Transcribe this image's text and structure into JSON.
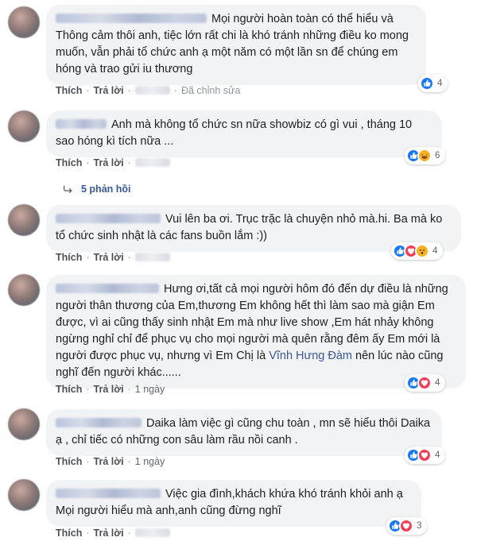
{
  "actions": {
    "like": "Thích",
    "reply": "Trả lời",
    "separator": "·"
  },
  "comments": [
    {
      "text": "Mọi người hoàn toàn có thể hiểu và Thông cảm thôi anh, tiệc lớn rất chi là khó tránh những điều ko mong muốn, vẫn phải tổ chức anh ạ một năm có một lần sn để chúng em hóng và trao gửi iu thương",
      "meta": "Đã chỉnh sửa",
      "reaction_count": "4",
      "reactions": [
        "like-icon"
      ]
    },
    {
      "text": "Anh mà không tổ chức sn nữa showbiz có gì vui , tháng 10 sao hóng kì tích nữa ...",
      "meta": "",
      "reaction_count": "6",
      "reactions": [
        "like-icon",
        "haha-icon"
      ],
      "replies": "5 phản hồi"
    },
    {
      "text": "Vui lên ba ơi. Trục trặc là chuyện nhỏ mà.hi. Ba mà ko tổ chức sinh nhật là các fans buồn lắm :))",
      "meta": "",
      "reaction_count": "4",
      "reactions": [
        "like-icon",
        "love-icon",
        "wow-icon"
      ]
    },
    {
      "text_before": "Hưng ơi,tất cả mọi người hôm đó đến dự điều là những người thân thương của Em,thương Em không hết thì làm sao mà giận Em được, vì ai cũng thấy sinh nhật Em mà như live show ,Em hát nhảy không ngừng nghỉ chỉ để phục vụ cho mọi người mà quên rằng đêm ấy Em mới là người được phục vụ, nhưng vì Em Chị là ",
      "text_link": "Vĩnh Hưng Đàm",
      "text_after": " nên lúc nào cũng nghĩ đến người khác......",
      "meta": "1 ngày",
      "reaction_count": "4",
      "reactions": [
        "like-icon",
        "love-icon"
      ]
    },
    {
      "text": "Daika làm việc gì cũng chu toàn , mn sẽ hiểu thôi Daika ạ , chỉ tiếc có những con sâu làm rầu nồi canh .",
      "meta": "1 ngày",
      "reaction_count": "4",
      "reactions": [
        "like-icon",
        "love-icon"
      ]
    },
    {
      "text": "Việc gia đình,khách khứa khó tránh khỏi anh ạ Mọi người hiểu mà anh,anh cũng đừng nghĩ",
      "meta": "",
      "reaction_count": "3",
      "reactions": [
        "like-icon",
        "love-icon"
      ]
    }
  ],
  "colors": {
    "bubble": "#f2f3f5",
    "link": "#385898",
    "like": "#1877f2",
    "love": "#f33e58",
    "haha": "#f7b125"
  }
}
